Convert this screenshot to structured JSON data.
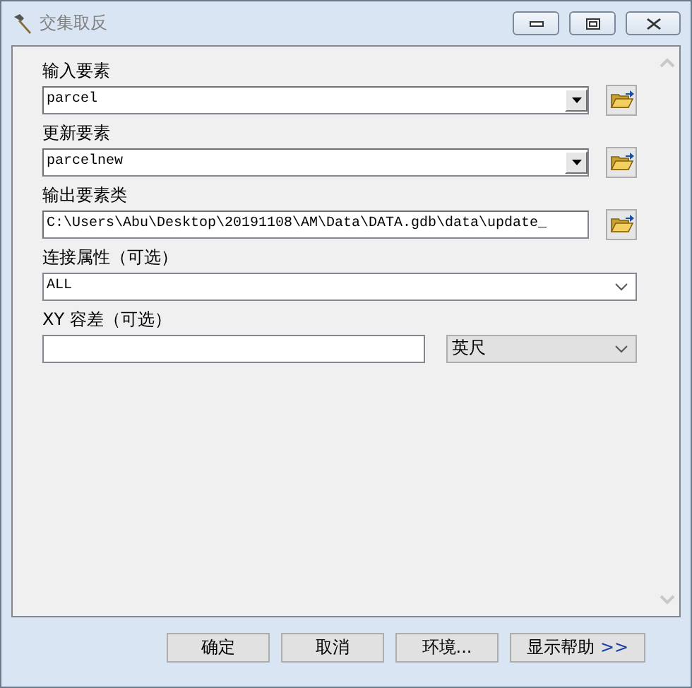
{
  "window": {
    "title": "交集取反"
  },
  "parameters": [
    {
      "kind": "combo",
      "label": "输入要素",
      "value": "parcel"
    },
    {
      "kind": "combo",
      "label": "更新要素",
      "value": "parcelnew"
    },
    {
      "kind": "output",
      "label": "输出要素类",
      "value": "C:\\Users\\Abu\\Desktop\\20191108\\AM\\Data\\DATA.gdb\\data\\update_"
    },
    {
      "kind": "dropdown",
      "label": "连接属性（可选）",
      "value": "ALL"
    },
    {
      "kind": "linear",
      "label": "XY 容差（可选）",
      "unit": "英尺"
    }
  ],
  "buttons": [
    {
      "label": "确定"
    },
    {
      "label": "取消"
    },
    {
      "label": "环境..."
    },
    {
      "label": "显示帮助",
      "suffix": ">>"
    }
  ]
}
